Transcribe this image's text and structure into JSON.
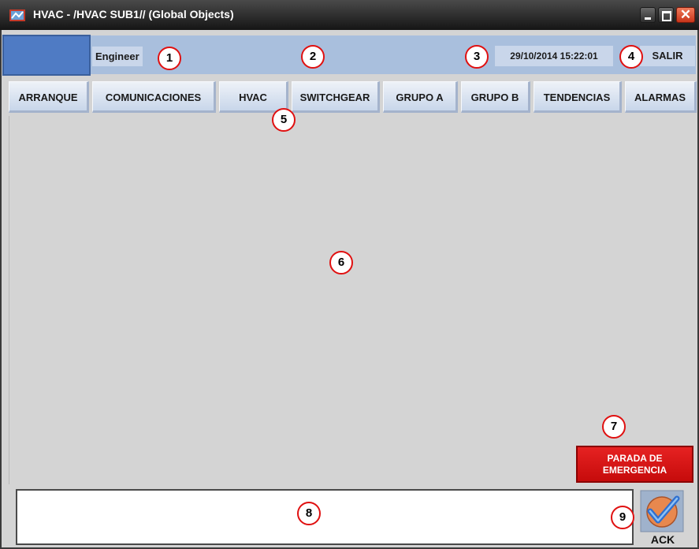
{
  "window": {
    "title": "HVAC - /HVAC SUB1// (Global Objects)",
    "close_glyph": "✕"
  },
  "header": {
    "user": "Engineer",
    "datetime": "29/10/2014 15:22:01",
    "exit_label": "SALIR"
  },
  "nav": {
    "tabs": [
      {
        "label": "ARRANQUE"
      },
      {
        "label": "COMUNICACIONES"
      },
      {
        "label": "HVAC"
      },
      {
        "label": "SWITCHGEAR"
      },
      {
        "label": "GRUPO A"
      },
      {
        "label": "GRUPO B"
      },
      {
        "label": "TENDENCIAS"
      },
      {
        "label": "ALARMAS"
      }
    ]
  },
  "emergency": {
    "line1": "PARADA DE",
    "line2": "EMERGENCIA"
  },
  "ack": {
    "label": "ACK",
    "icon": "checkmark-icon"
  },
  "markers": [
    "1",
    "2",
    "3",
    "4",
    "5",
    "6",
    "7",
    "8",
    "9"
  ],
  "colors": {
    "header_strip": "#a9bfdd",
    "emergency": "#d41414",
    "marker_ring": "#e01010"
  }
}
